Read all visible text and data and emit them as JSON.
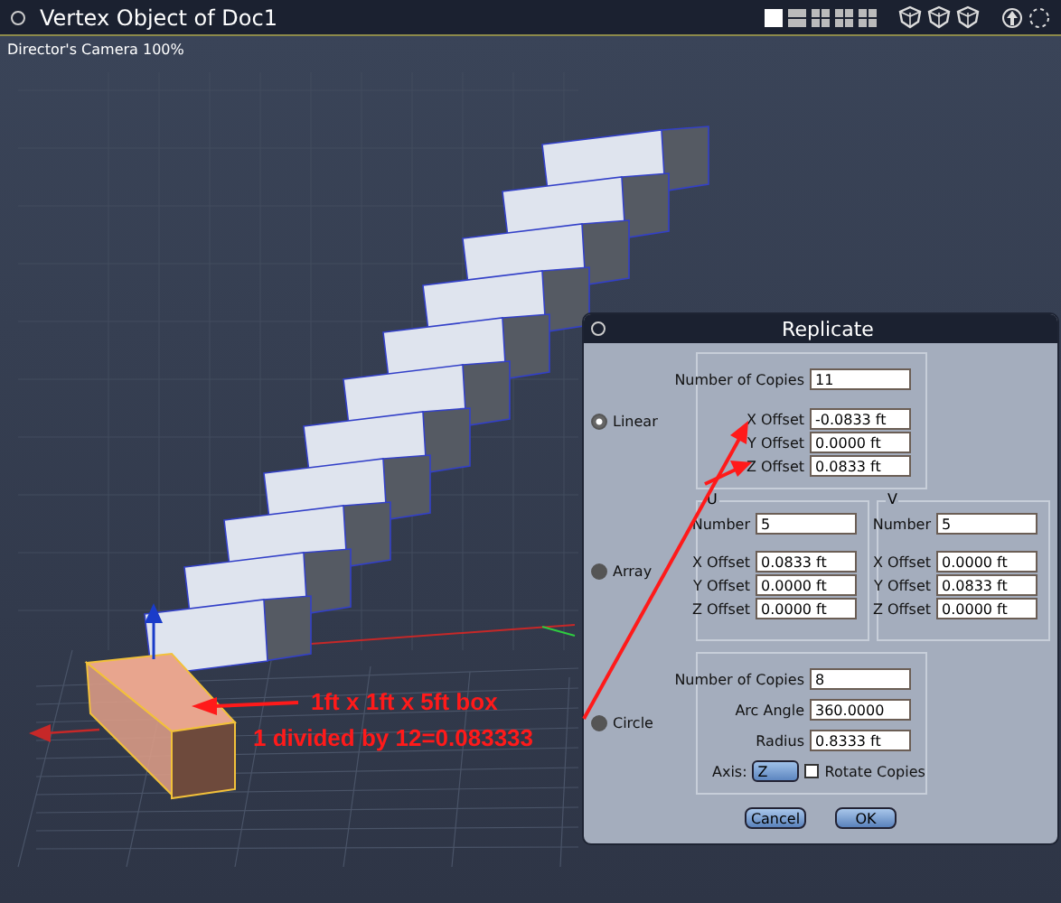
{
  "window": {
    "title": "Vertex Object of Doc1"
  },
  "viewport": {
    "camera_label": "Director's Camera 100%"
  },
  "annotations": [
    "1ft x 1ft x 5ft box",
    "1 divided by 12=0.083333"
  ],
  "dialog": {
    "title": "Replicate",
    "modes": [
      {
        "kind": "linear",
        "label": "Linear",
        "selected": true,
        "fields": [
          {
            "label": "Number of Copies",
            "value": "11"
          },
          {
            "label": "X Offset",
            "value": "-0.0833 ft"
          },
          {
            "label": "Y Offset",
            "value": "0.0000 ft"
          },
          {
            "label": "Z Offset",
            "value": "0.0833 ft"
          }
        ]
      },
      {
        "kind": "array",
        "label": "Array",
        "selected": false,
        "groups": [
          {
            "title": "U",
            "fields": [
              {
                "label": "Number",
                "value": "5"
              },
              {
                "label": "X Offset",
                "value": "0.0833 ft"
              },
              {
                "label": "Y Offset",
                "value": "0.0000 ft"
              },
              {
                "label": "Z Offset",
                "value": "0.0000 ft"
              }
            ]
          },
          {
            "title": "V",
            "fields": [
              {
                "label": "Number",
                "value": "5"
              },
              {
                "label": "X Offset",
                "value": "0.0000 ft"
              },
              {
                "label": "Y Offset",
                "value": "0.0833 ft"
              },
              {
                "label": "Z Offset",
                "value": "0.0000 ft"
              }
            ]
          }
        ]
      },
      {
        "kind": "circle",
        "label": "Circle",
        "selected": false,
        "fields": [
          {
            "label": "Number of Copies",
            "value": "8"
          },
          {
            "label": "Arc Angle",
            "value": "360.0000"
          },
          {
            "label": "Radius",
            "value": "0.8333 ft"
          }
        ],
        "axis": {
          "label": "Axis:",
          "value": "Z"
        },
        "rotate": {
          "label": "Rotate Copies",
          "checked": false
        }
      }
    ],
    "buttons": [
      "Cancel",
      "OK"
    ]
  }
}
